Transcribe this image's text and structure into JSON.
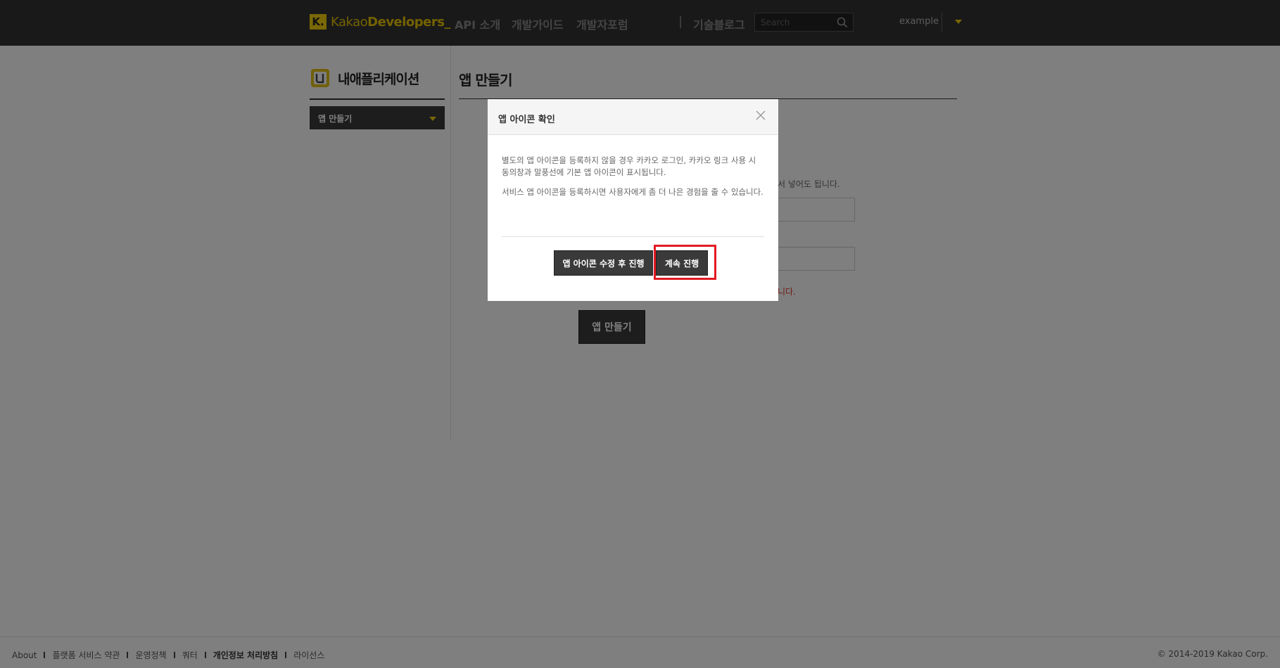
{
  "header": {
    "logo_k": "K.",
    "logo_light": "Kakao",
    "logo_bold": "Developers_",
    "nav": [
      "API 소개",
      "개발가이드",
      "개발자포럼"
    ],
    "nav_sep": "|",
    "tech_blog": "기술블로그",
    "search_placeholder": "Search",
    "user": "example"
  },
  "sidebar": {
    "title": "내애플리케이션",
    "select_value": "앱 만들기"
  },
  "main": {
    "title": "앱 만들기",
    "behind_hint": "서 넣어도 됩니다.",
    "behind_error": "니다.",
    "create_button": "앱 만들기"
  },
  "modal": {
    "title": "앱 아이콘 확인",
    "paragraph1": "별도의 앱 아이콘을 등록하지 않을 경우 카카오 로그인, 카카오 링크 사용 시 동의창과 말풍선에 기본 앱 아이콘이 표시됩니다.",
    "paragraph2": "서비스 앱 아이콘을 등록하시면 사용자에게 좀 더 나은 경험을 줄 수 있습니다.",
    "btn_modify": "앱 아이콘 수정 후 진행",
    "btn_continue": "계속 진행"
  },
  "footer": {
    "links": [
      "About",
      "플랫폼 서비스 약관",
      "운영정책",
      "쿼터",
      "개인정보 처리방침",
      "라이선스"
    ],
    "copyright": "© 2014-2019 Kakao Corp."
  },
  "colors": {
    "brand_yellow": "#f5d10e",
    "header_bg": "#333333",
    "button_dark": "#3a3a3a",
    "highlight_red": "#e21a22"
  }
}
